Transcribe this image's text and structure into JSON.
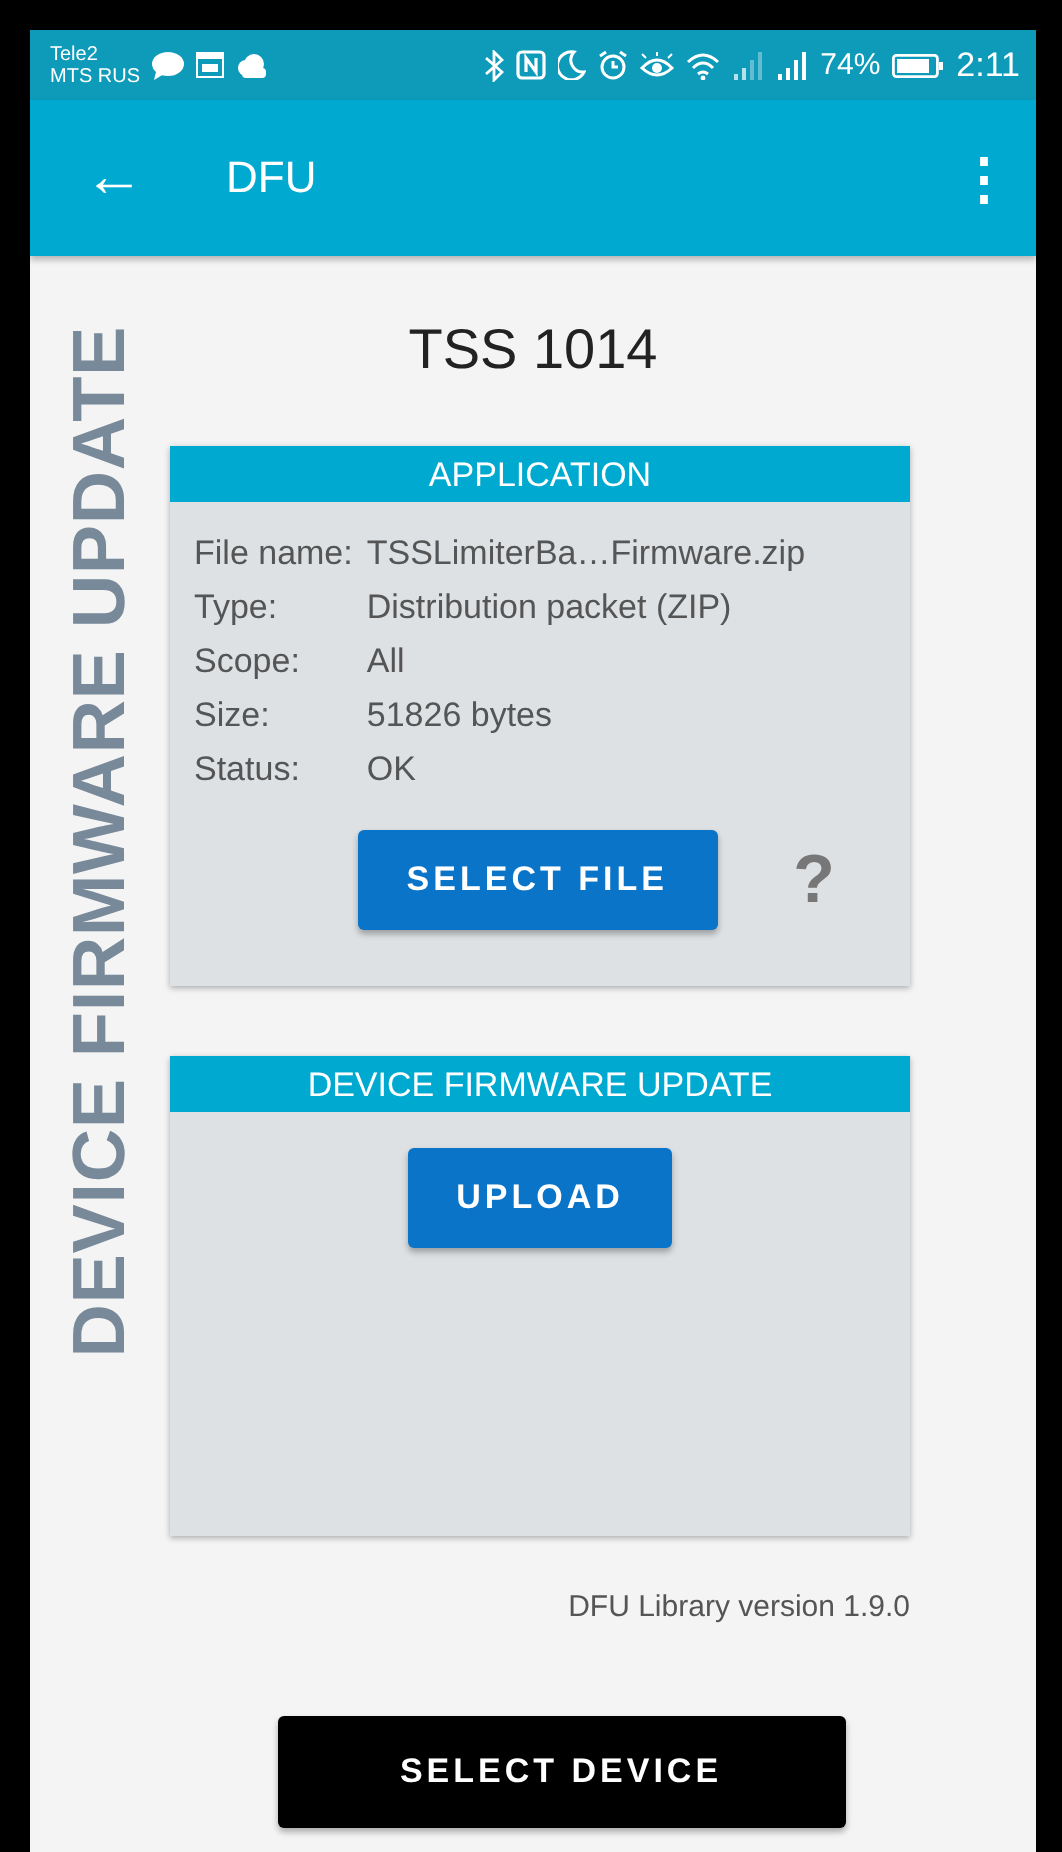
{
  "status_bar": {
    "carriers": [
      "Tele2",
      "MTS RUS"
    ],
    "battery": "74%",
    "time": "2:11"
  },
  "toolbar": {
    "back": "←",
    "title": "DFU",
    "menu": "⋮"
  },
  "side_label": "DEVICE FIRMWARE UPDATE",
  "device_name": "TSS 1014",
  "application": {
    "header": "APPLICATION",
    "fields": [
      {
        "label": "File name:",
        "value": "TSSLimiterBa…Firmware.zip"
      },
      {
        "label": "Type:",
        "value": "Distribution packet (ZIP)"
      },
      {
        "label": "Scope:",
        "value": "All"
      },
      {
        "label": "Size:",
        "value": "51826 bytes"
      },
      {
        "label": "Status:",
        "value": "OK"
      }
    ],
    "button": "SELECT FILE",
    "help": "?"
  },
  "dfu": {
    "header": "DEVICE FIRMWARE UPDATE",
    "button": "UPLOAD"
  },
  "library_version": "DFU Library version 1.9.0",
  "select_device_button": "SELECT DEVICE"
}
